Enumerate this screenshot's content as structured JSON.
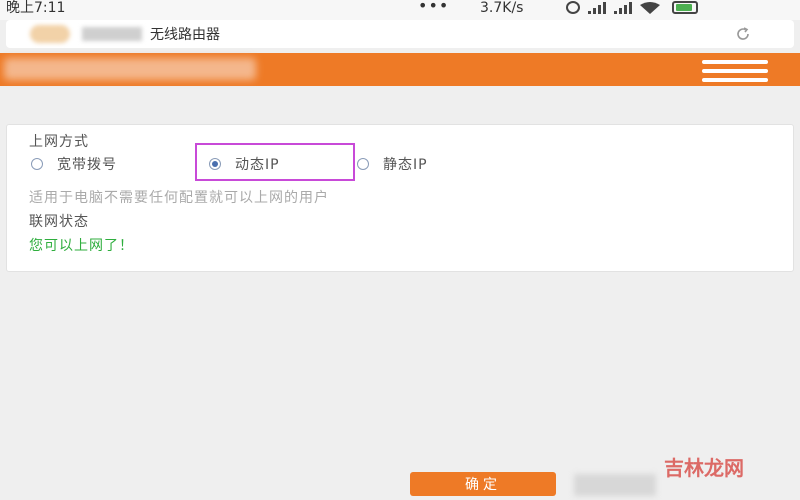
{
  "status_bar": {
    "time": "晚上7:11",
    "dots": "•••",
    "network_speed": "3.7K/s"
  },
  "browser": {
    "title": "无线路由器"
  },
  "form": {
    "connection_label": "上网方式",
    "options": [
      {
        "label": "宽带拨号",
        "selected": false
      },
      {
        "label": "动态IP",
        "selected": true
      },
      {
        "label": "静态IP",
        "selected": false
      }
    ],
    "hint": "适用于电脑不需要任何配置就可以上网的用户",
    "status_label": "联网状态",
    "status_value": "您可以上网了！"
  },
  "confirm_label": "确定",
  "watermark": "吉林龙网",
  "colors": {
    "brand_orange": "#ee7a26",
    "success_green": "#2fae3e",
    "highlight_purple": "#c84ad8"
  }
}
